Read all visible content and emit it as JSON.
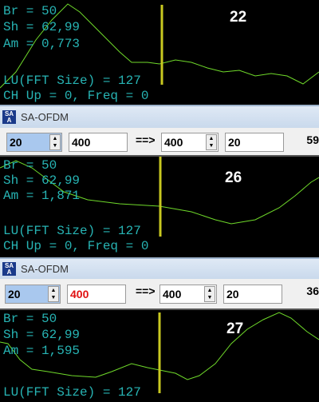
{
  "window_title": "SA-OFDM",
  "app_icon": "sa-logo-icon",
  "arrow_label": "==>",
  "panels": [
    {
      "lines": [
        "Br = 50",
        "Sh = 62,99",
        "Am = 0,773",
        "",
        "",
        "LU(FFT Size) = 127",
        "CH Up = 0, Freq = 0"
      ],
      "number": "22"
    },
    {
      "lines": [
        "Br = 50",
        "Sh = 62,99",
        "Am = 1,871",
        "",
        "",
        "LU(FFT Size) = 127",
        "CH Up = 0, Freq = 0"
      ],
      "number": "26"
    },
    {
      "lines": [
        "Br = 50",
        "Sh = 62,99",
        "Am = 1,595",
        "",
        "",
        "LU(FFT Size) = 127"
      ],
      "number": "27"
    }
  ],
  "toolbars": [
    {
      "field1": "20",
      "field2": "400",
      "field3": "400",
      "field4": "20",
      "count": "59",
      "field2_color": "#000000"
    },
    {
      "field1": "20",
      "field2": "400",
      "field3": "400",
      "field4": "20",
      "count": "36",
      "field2_color": "#e01010"
    }
  ],
  "colors": {
    "trace": "#6fd92a",
    "marker": "#c8c820",
    "text": "#27b4b4"
  }
}
